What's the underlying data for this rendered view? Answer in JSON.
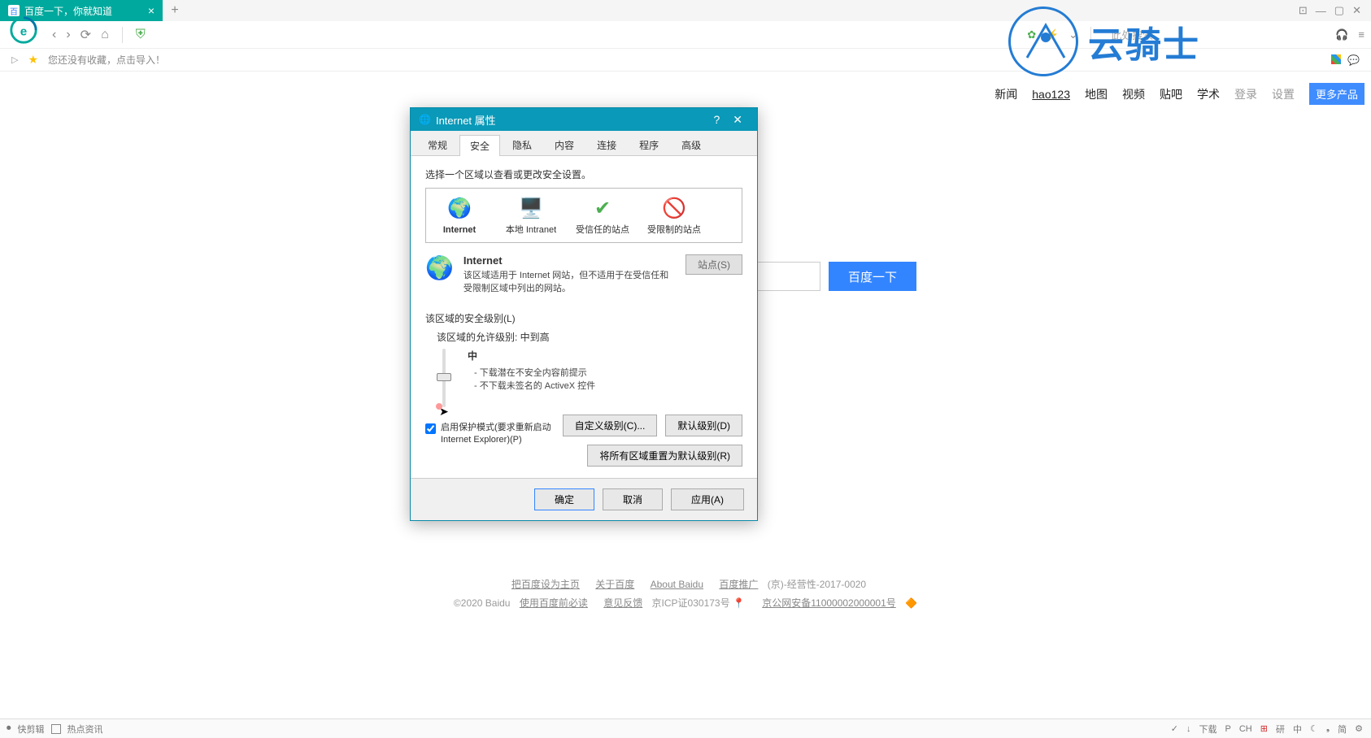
{
  "tab": {
    "title": "百度一下，你就知道",
    "new": "+"
  },
  "window": {
    "help": "?",
    "min": "—",
    "max": "▢",
    "close": "✕"
  },
  "nav": {
    "back": "‹",
    "fwd": "›",
    "reload": "⟳",
    "home": "⌂"
  },
  "toolbar_right": {
    "search_placeholder": "此处搜索",
    "headset": "🎧",
    "menu": "≡"
  },
  "favbar": {
    "text": "您还没有收藏，点击导入！"
  },
  "page_nav": [
    "新闻",
    "hao123",
    "地图",
    "视频",
    "贴吧",
    "学术",
    "登录",
    "设置"
  ],
  "page_nav_more": "更多产品",
  "baidu_btn": "百度一下",
  "dialog": {
    "title": "Internet 属性",
    "tabs": [
      "常规",
      "安全",
      "隐私",
      "内容",
      "连接",
      "程序",
      "高级"
    ],
    "active_tab": 1,
    "zone_label": "选择一个区域以查看或更改安全设置。",
    "zones": [
      {
        "label": "Internet"
      },
      {
        "label": "本地 Intranet"
      },
      {
        "label": "受信任的站点"
      },
      {
        "label": "受限制的站点"
      }
    ],
    "zone_detail": {
      "name": "Internet",
      "desc": "该区域适用于 Internet 网站，但不适用于在受信任和受限制区域中列出的网站。",
      "sites_btn": "站点(S)"
    },
    "sec": {
      "hdr": "该区域的安全级别(L)",
      "sub": "该区域的允许级别: 中到高",
      "level": "中",
      "bul1": "- 下载潜在不安全内容前提示",
      "bul2": "- 不下载未签名的 ActiveX 控件"
    },
    "chk_label": "启用保护模式(要求重新启动 Internet Explorer)(P)",
    "btn_custom": "自定义级别(C)...",
    "btn_default": "默认级别(D)",
    "btn_reset": "将所有区域重置为默认级别(R)",
    "ok": "确定",
    "cancel": "取消",
    "apply": "应用(A)"
  },
  "footer": {
    "links": [
      "把百度设为主页",
      "关于百度",
      "About Baidu",
      "百度推广"
    ],
    "biz": "(京)-经营性-2017-0020",
    "line2_pre": "©2020 Baidu ",
    "line2_links": [
      "使用百度前必读",
      "意见反馈"
    ],
    "icp": " 京ICP证030173号 ",
    "police": "京公网安备11000002000001号"
  },
  "watermark": "云骑士",
  "statusbar": {
    "left": [
      "快剪辑",
      "热点资讯"
    ],
    "right": [
      "✓",
      "↓",
      "下载",
      "P",
      "CH",
      "研",
      "中",
      "简"
    ]
  }
}
